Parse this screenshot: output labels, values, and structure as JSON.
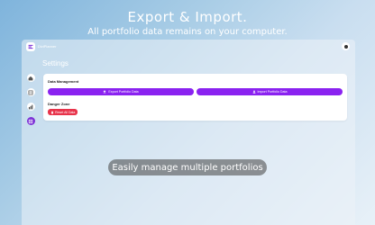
{
  "hero": {
    "title": "Export & Import.",
    "subtitle": "All portfolio data remains on your computer."
  },
  "app": {
    "name": "DiviPlanner",
    "page_title": "Settings",
    "sidebar": [
      {
        "icon": "home-icon"
      },
      {
        "icon": "table-icon"
      },
      {
        "icon": "chart-icon"
      },
      {
        "icon": "settings-icon",
        "active": true
      }
    ]
  },
  "data_management": {
    "label": "Data Management",
    "export_label": "Export Portfolio Data",
    "import_label": "Import Portfolio Data"
  },
  "danger_zone": {
    "label": "Danger Zone",
    "reset_label": "Reset All Data"
  },
  "caption": "Easily manage multiple portfolios",
  "colors": {
    "accent": "#8a22f0",
    "danger": "#e8334a",
    "active_nav": "#7b2fd6"
  }
}
